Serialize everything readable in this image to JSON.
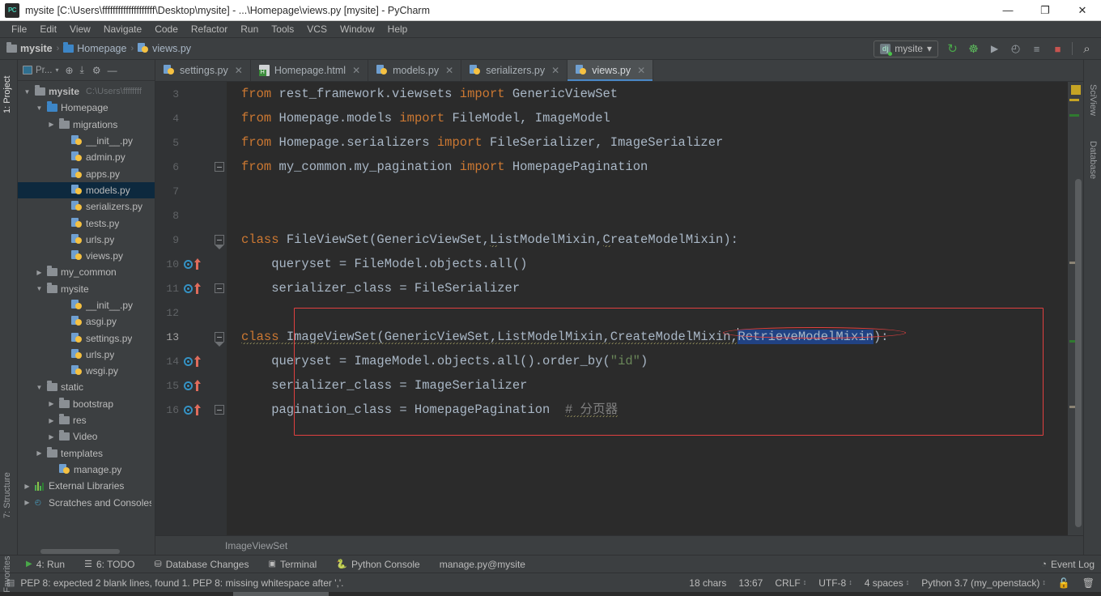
{
  "window": {
    "title": "mysite [C:\\Users\\ffffffffffffffffffff\\Desktop\\mysite] - ...\\Homepage\\views.py [mysite] - PyCharm",
    "app_icon": "PC",
    "minimize": "—",
    "maximize": "❐",
    "close": "✕"
  },
  "menu": [
    {
      "label": "File"
    },
    {
      "label": "Edit"
    },
    {
      "label": "View"
    },
    {
      "label": "Navigate"
    },
    {
      "label": "Code"
    },
    {
      "label": "Refactor"
    },
    {
      "label": "Run"
    },
    {
      "label": "Tools"
    },
    {
      "label": "VCS"
    },
    {
      "label": "Window"
    },
    {
      "label": "Help"
    }
  ],
  "navbar": {
    "breadcrumbs": [
      {
        "label": "mysite",
        "icon": "folder-icon"
      },
      {
        "label": "Homepage",
        "icon": "folder-blue-icon"
      },
      {
        "label": "views.py",
        "icon": "python-file-icon"
      }
    ],
    "separator": "›",
    "run_config": "mysite",
    "run_config_caret": "▾",
    "actions": [
      {
        "name": "update-project-icon",
        "glyph": "↻"
      },
      {
        "name": "debug-icon",
        "glyph": "☸"
      },
      {
        "name": "run-icon",
        "glyph": "▶"
      },
      {
        "name": "run-with-coverage-icon",
        "glyph": "◴"
      },
      {
        "name": "run-manage-task-icon",
        "glyph": "≡"
      },
      {
        "name": "stop-icon",
        "glyph": "■"
      },
      {
        "name": "search-everywhere-icon",
        "glyph": "⌕"
      }
    ]
  },
  "left_rail": [
    {
      "label": "1: Project",
      "active": true
    },
    {
      "label": "7: Structure",
      "active": false
    },
    {
      "label": "2: Favorites",
      "active": false
    }
  ],
  "right_rail": [
    {
      "label": "SciView"
    },
    {
      "label": "Database"
    }
  ],
  "project_panel": {
    "title": "Pr...",
    "header_icons": [
      {
        "name": "locate-icon",
        "glyph": "⊕"
      },
      {
        "name": "collapse-all-icon",
        "glyph": "⤓"
      },
      {
        "name": "settings-gear-icon",
        "glyph": "⚙"
      },
      {
        "name": "hide-panel-icon",
        "glyph": "—"
      }
    ],
    "tree": [
      {
        "indent": 0,
        "arrow": "down",
        "icon": "folder-icon",
        "label": "mysite",
        "bold": true,
        "path": "C:\\Users\\ffffffff",
        "selected": false
      },
      {
        "indent": 1,
        "arrow": "down",
        "icon": "folder-blue-icon",
        "label": "Homepage",
        "selected": false
      },
      {
        "indent": 2,
        "arrow": "right",
        "icon": "folder-icon",
        "label": "migrations",
        "selected": false
      },
      {
        "indent": 3,
        "arrow": "none",
        "icon": "python-file-icon",
        "label": "__init__.py",
        "selected": false
      },
      {
        "indent": 3,
        "arrow": "none",
        "icon": "python-file-icon",
        "label": "admin.py",
        "selected": false
      },
      {
        "indent": 3,
        "arrow": "none",
        "icon": "python-file-icon",
        "label": "apps.py",
        "selected": false
      },
      {
        "indent": 3,
        "arrow": "none",
        "icon": "python-file-icon",
        "label": "models.py",
        "selected": true
      },
      {
        "indent": 3,
        "arrow": "none",
        "icon": "python-file-icon",
        "label": "serializers.py",
        "selected": false
      },
      {
        "indent": 3,
        "arrow": "none",
        "icon": "python-file-icon",
        "label": "tests.py",
        "selected": false
      },
      {
        "indent": 3,
        "arrow": "none",
        "icon": "python-file-icon",
        "label": "urls.py",
        "selected": false
      },
      {
        "indent": 3,
        "arrow": "none",
        "icon": "python-file-icon",
        "label": "views.py",
        "selected": false
      },
      {
        "indent": 1,
        "arrow": "right",
        "icon": "folder-icon",
        "label": "my_common",
        "selected": false
      },
      {
        "indent": 1,
        "arrow": "down",
        "icon": "folder-icon",
        "label": "mysite",
        "selected": false
      },
      {
        "indent": 3,
        "arrow": "none",
        "icon": "python-file-icon",
        "label": "__init__.py",
        "selected": false
      },
      {
        "indent": 3,
        "arrow": "none",
        "icon": "python-file-icon",
        "label": "asgi.py",
        "selected": false
      },
      {
        "indent": 3,
        "arrow": "none",
        "icon": "python-file-icon",
        "label": "settings.py",
        "selected": false
      },
      {
        "indent": 3,
        "arrow": "none",
        "icon": "python-file-icon",
        "label": "urls.py",
        "selected": false
      },
      {
        "indent": 3,
        "arrow": "none",
        "icon": "python-file-icon",
        "label": "wsgi.py",
        "selected": false
      },
      {
        "indent": 1,
        "arrow": "down",
        "icon": "folder-icon",
        "label": "static",
        "selected": false
      },
      {
        "indent": 2,
        "arrow": "right",
        "icon": "folder-icon",
        "label": "bootstrap",
        "selected": false
      },
      {
        "indent": 2,
        "arrow": "right",
        "icon": "folder-icon",
        "label": "res",
        "selected": false
      },
      {
        "indent": 2,
        "arrow": "right",
        "icon": "folder-icon",
        "label": "Video",
        "selected": false
      },
      {
        "indent": 1,
        "arrow": "right",
        "icon": "folder-icon",
        "label": "templates",
        "selected": false
      },
      {
        "indent": 2,
        "arrow": "none",
        "icon": "python-file-icon",
        "label": "manage.py",
        "selected": false
      },
      {
        "indent": 0,
        "arrow": "right",
        "icon": "library-icon",
        "label": "External Libraries",
        "selected": false
      },
      {
        "indent": 0,
        "arrow": "right",
        "icon": "scratches-icon",
        "label": "Scratches and Consoles",
        "selected": false
      }
    ]
  },
  "editor_tabs": [
    {
      "label": "settings.py",
      "icon": "python-file-icon",
      "active": false,
      "close": "✕"
    },
    {
      "label": "Homepage.html",
      "icon": "html-file-icon",
      "active": false,
      "close": "✕"
    },
    {
      "label": "models.py",
      "icon": "python-file-icon",
      "active": false,
      "close": "✕"
    },
    {
      "label": "serializers.py",
      "icon": "python-file-icon",
      "active": false,
      "close": "✕"
    },
    {
      "label": "views.py",
      "icon": "python-file-icon",
      "active": true,
      "close": "✕"
    }
  ],
  "code": {
    "lines": [
      {
        "num": "3",
        "text": "from rest_framework.viewsets import GenericViewSet"
      },
      {
        "num": "4",
        "text": "from Homepage.models import FileModel, ImageModel"
      },
      {
        "num": "5",
        "text": "from Homepage.serializers import FileSerializer, ImageSerializer"
      },
      {
        "num": "6",
        "text": "from my_common.my_pagination import HomepagePagination"
      },
      {
        "num": "7",
        "text": ""
      },
      {
        "num": "8",
        "text": ""
      },
      {
        "num": "9",
        "text": "class FileViewSet(GenericViewSet,ListModelMixin,CreateModelMixin):"
      },
      {
        "num": "10",
        "text": "    queryset = FileModel.objects.all()"
      },
      {
        "num": "11",
        "text": "    serializer_class = FileSerializer"
      },
      {
        "num": "12",
        "text": ""
      },
      {
        "num": "13",
        "text": "class ImageViewSet(GenericViewSet,ListModelMixin,CreateModelMixin,RetrieveModelMixin):"
      },
      {
        "num": "14",
        "text": "    queryset = ImageModel.objects.all().order_by(\"id\")"
      },
      {
        "num": "15",
        "text": "    serializer_class = ImageSerializer"
      },
      {
        "num": "16",
        "text": "    pagination_class = HomepagePagination  # 分页器"
      }
    ],
    "tokens": {
      "kw_from": "from",
      "kw_import": "import",
      "kw_class": "class",
      "selected_text": "RetrieveModelMixin",
      "comment": "# 分页器",
      "string_id": "\"id\""
    },
    "colors": {
      "keyword": "#cc7832",
      "string": "#6a8759",
      "comment": "#808080",
      "text": "#a9b7c6",
      "selection": "#214283",
      "annotation": "#e04040",
      "background": "#2b2b2b"
    }
  },
  "editor_status": {
    "breadcrumb": "ImageViewSet"
  },
  "tool_windows": [
    {
      "label": "4: Run",
      "icon": "run-icon"
    },
    {
      "label": "6: TODO",
      "icon": "todo-icon"
    },
    {
      "label": "Database Changes",
      "icon": "database-changes-icon"
    },
    {
      "label": "Terminal",
      "icon": "terminal-icon"
    },
    {
      "label": "Python Console",
      "icon": "python-console-icon"
    },
    {
      "label": "manage.py@mysite",
      "icon": "none"
    }
  ],
  "event_log": {
    "label": "Event Log",
    "icon": "event-log-icon"
  },
  "statusbar": {
    "message": "PEP 8: expected 2 blank lines, found 1. PEP 8: missing whitespace after ','.",
    "message_icon": "inspection-icon",
    "chars": "18 chars",
    "caret_position": "13:67",
    "line_separator": "CRLF",
    "encoding": "UTF-8",
    "indent": "4 spaces",
    "interpreter": "Python 3.7 (my_openstack)",
    "updown": "↕",
    "lock_icon": "lock-icon",
    "trash_icon": "trash-icon"
  }
}
